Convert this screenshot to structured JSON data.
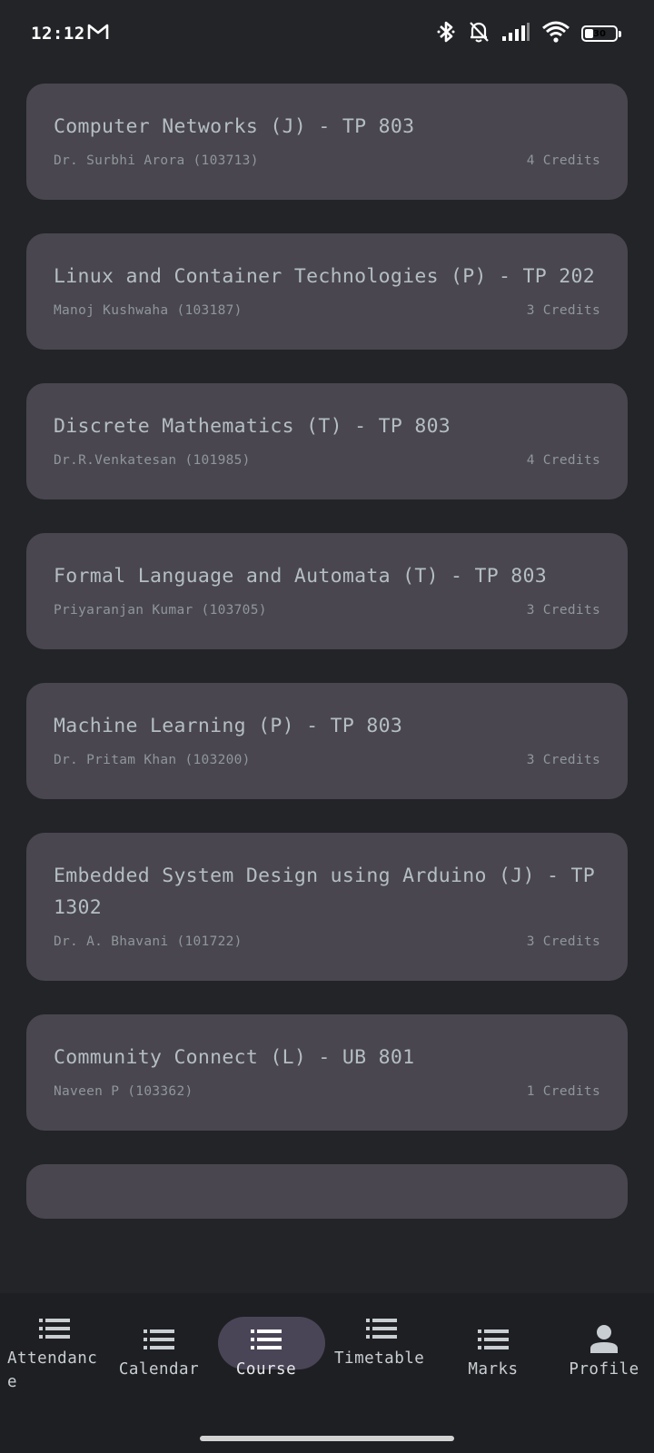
{
  "status_bar": {
    "time": "12:12",
    "battery": "30",
    "battery_level_percent": 30,
    "icons": [
      "gmail-icon",
      "bluetooth-icon",
      "muted-bell-icon",
      "cell-signal-icon",
      "wifi-icon",
      "battery-icon"
    ]
  },
  "courses": [
    {
      "title": "Computer Networks (J) - TP 803",
      "instructor": "Dr. Surbhi Arora (103713)",
      "credits": "4 Credits"
    },
    {
      "title": "Linux and Container Technologies (P) - TP 202",
      "instructor": "Manoj Kushwaha (103187)",
      "credits": "3 Credits"
    },
    {
      "title": "Discrete Mathematics (T) - TP 803",
      "instructor": "Dr.R.Venkatesan (101985)",
      "credits": "4 Credits"
    },
    {
      "title": "Formal Language and Automata (T) - TP 803",
      "instructor": "Priyaranjan Kumar (103705)",
      "credits": "3 Credits"
    },
    {
      "title": "Machine Learning (P) - TP 803",
      "instructor": "Dr. Pritam Khan (103200)",
      "credits": "3 Credits"
    },
    {
      "title": "Embedded System Design using Arduino (J) - TP 1302",
      "instructor": "Dr. A. Bhavani (101722)",
      "credits": "3 Credits"
    },
    {
      "title": "Community Connect (L) - UB 801",
      "instructor": "Naveen P (103362)",
      "credits": "1 Credits"
    }
  ],
  "nav": {
    "items": [
      {
        "label": "Attendance",
        "icon": "list-icon"
      },
      {
        "label": "Calendar",
        "icon": "list-icon"
      },
      {
        "label": "Course",
        "icon": "list-icon",
        "active": true
      },
      {
        "label": "Timetable",
        "icon": "list-icon"
      },
      {
        "label": "Marks",
        "icon": "list-icon"
      },
      {
        "label": "Profile",
        "icon": "person-icon"
      }
    ]
  },
  "colors": {
    "background": "#222428",
    "card": "#49464f",
    "title_text": "#b4bec3",
    "meta_text": "#8f979b",
    "nav_background": "#1e1f23",
    "active_pill": "#4a4556"
  }
}
